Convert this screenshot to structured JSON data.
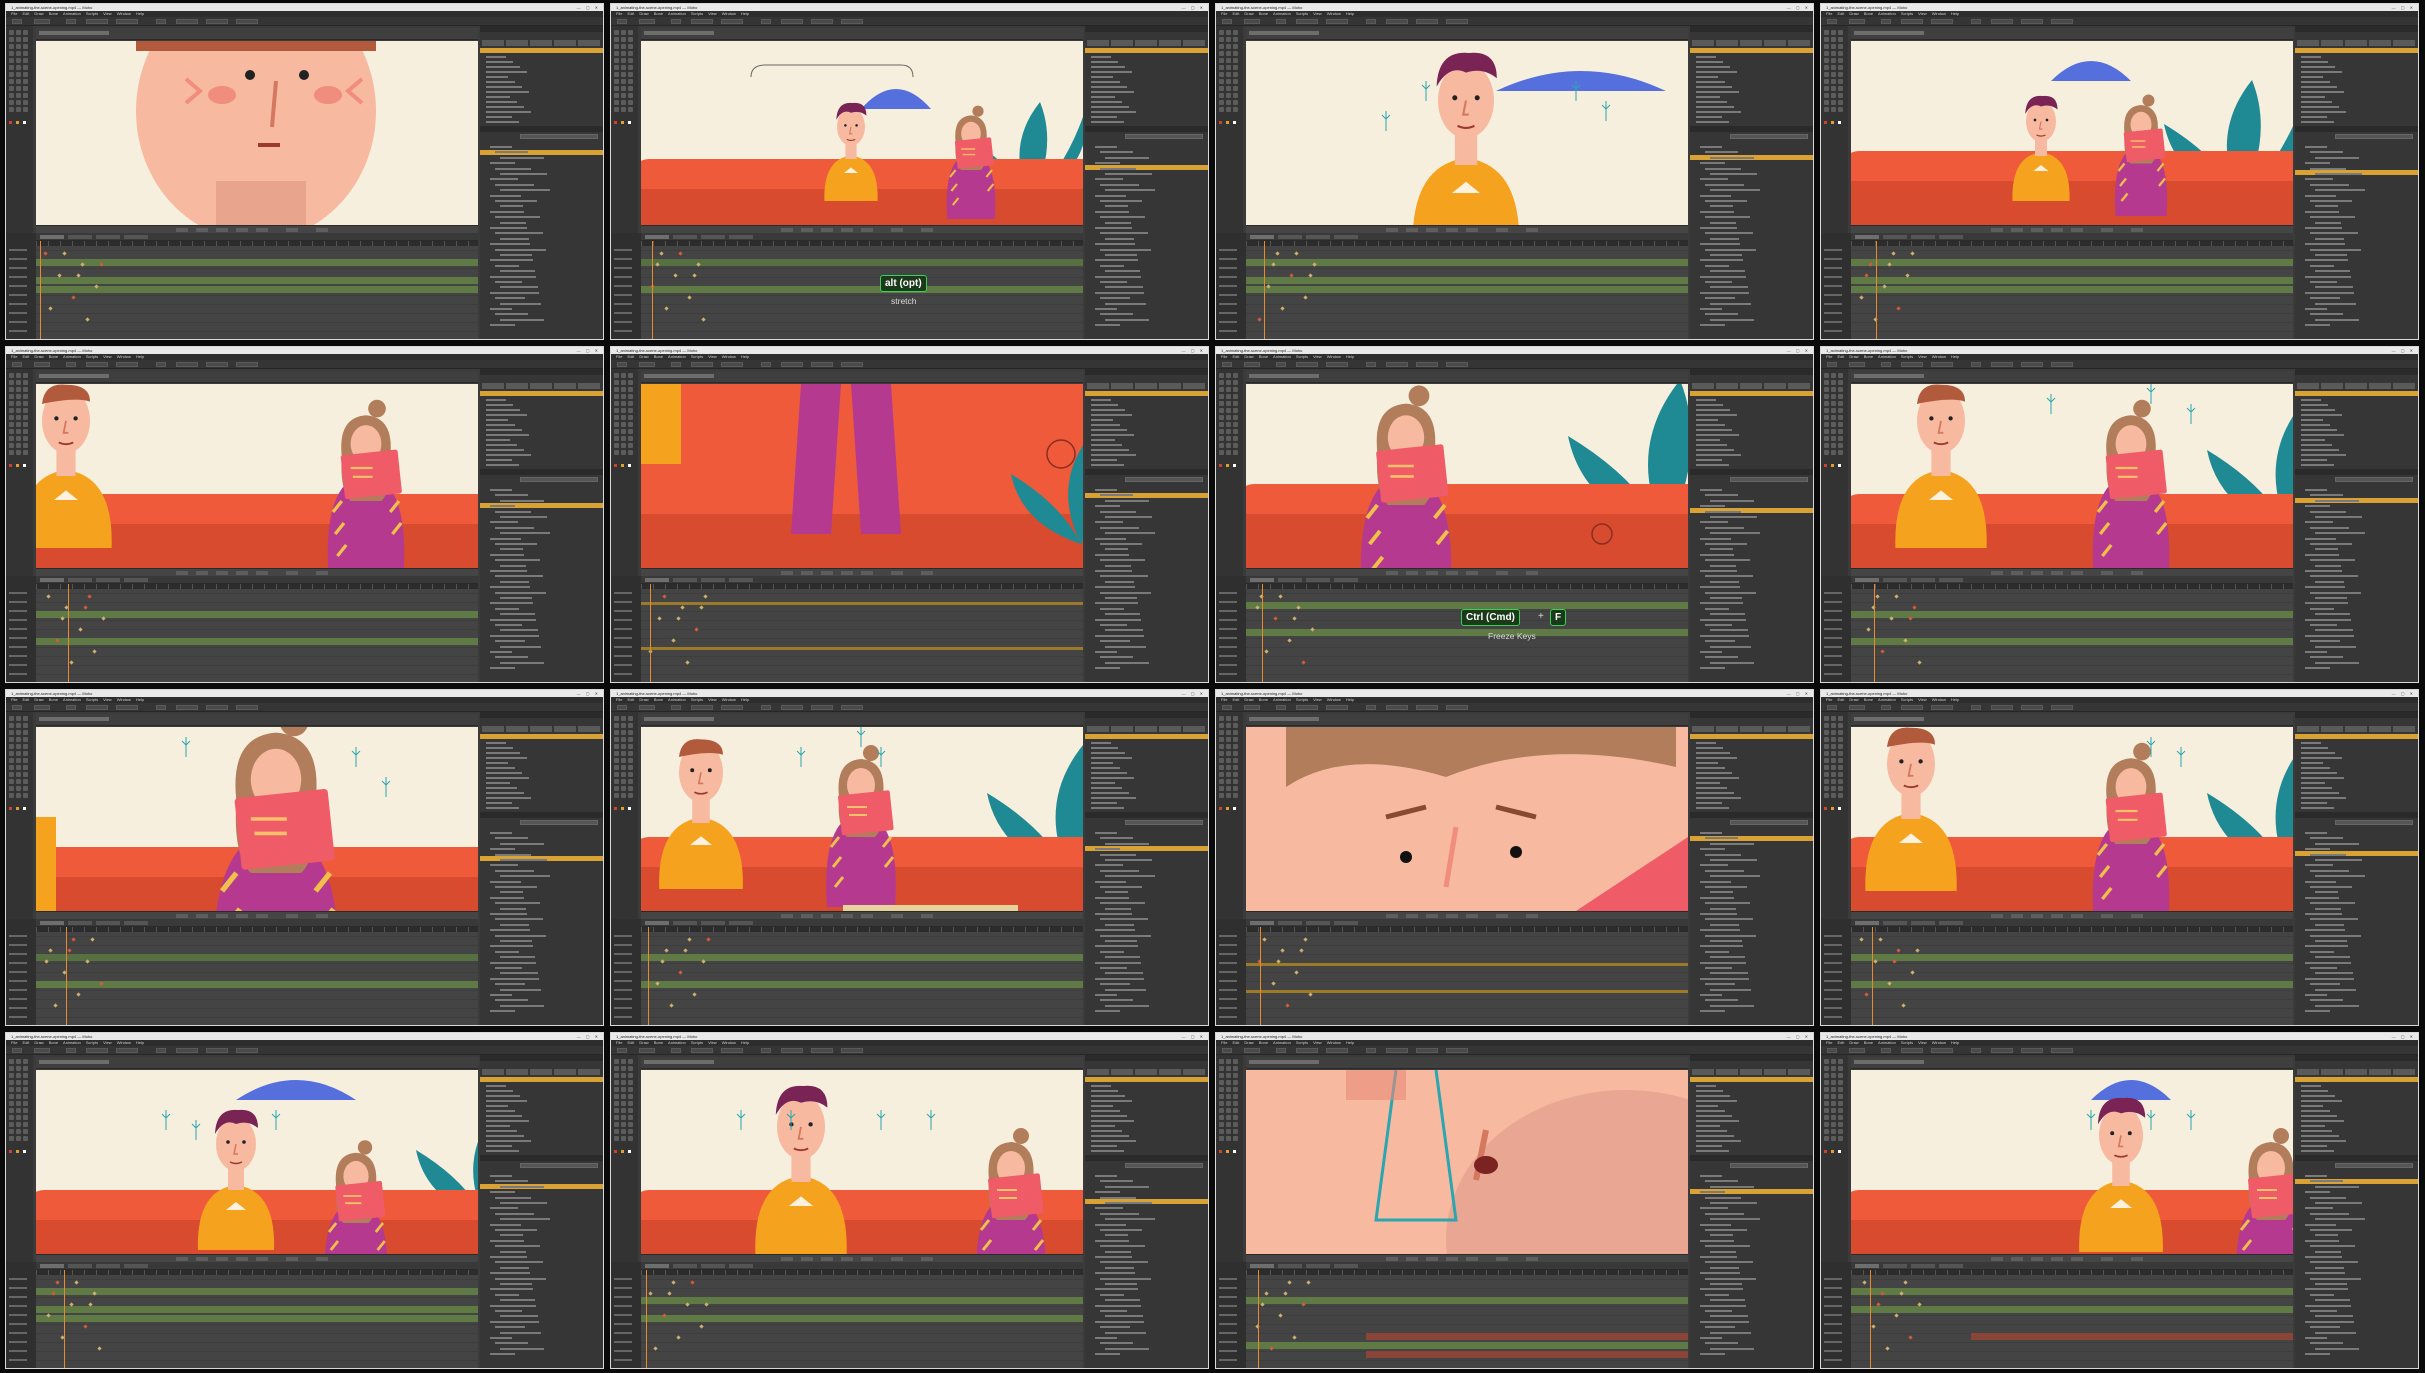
{
  "window": {
    "title": "1_animating-the-scene-opening.mp4 — Moho",
    "controls": "— ▢ ✕"
  },
  "menu": [
    "File",
    "Edit",
    "Draw",
    "Bone",
    "Animation",
    "Scripts",
    "View",
    "Window",
    "Help"
  ],
  "panels": {
    "right_tabs": [
      "Layers",
      "Sets",
      "Styles",
      "Characters"
    ],
    "timeline_tabs": [
      "Channels",
      "Sequencer",
      "Motion Graph",
      "Smooth"
    ]
  },
  "overlays": {
    "stretch": {
      "key": "alt (opt)",
      "caption": "stretch"
    },
    "freeze": {
      "keys": [
        "Ctrl (Cmd)",
        "F"
      ],
      "plus": "+",
      "caption": "Freeze Keys"
    }
  },
  "colors": {
    "canvas": "#f7efde",
    "skin": "#f7b9a0",
    "cheek": "#f08d7c",
    "shirt": "#f5a21e",
    "sofa": "#ef5a3a",
    "book": "#ef5b66",
    "plant": "#1f8a93",
    "umbrella": "#5570dc",
    "dress": "#b53a8f",
    "hair": "#b27d5a",
    "highlight": "#d8a234"
  }
}
